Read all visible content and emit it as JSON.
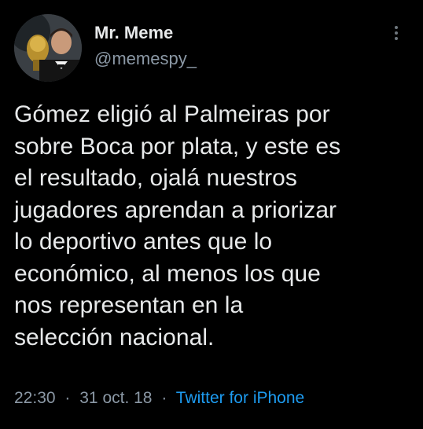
{
  "tweet": {
    "author": {
      "display_name": "Mr. Meme",
      "handle": "@memespy_",
      "avatar_icon": "user-avatar"
    },
    "text": "Gómez eligió al Palmeiras por\nsobre Boca por plata, y este es\nel resultado, ojalá nuestros\njugadores aprendan a priorizar\nlo deportivo antes que lo\neconómico, al menos los que\nnos representan en la\nselección nacional.",
    "time": "22:30",
    "date": "31 oct. 18",
    "separator": "·",
    "source": "Twitter for iPhone",
    "more_icon": "more-vertical-icon"
  },
  "colors": {
    "background": "#000000",
    "text": "#e7e9ea",
    "muted": "#8b98a5",
    "link": "#1d9bf0"
  }
}
